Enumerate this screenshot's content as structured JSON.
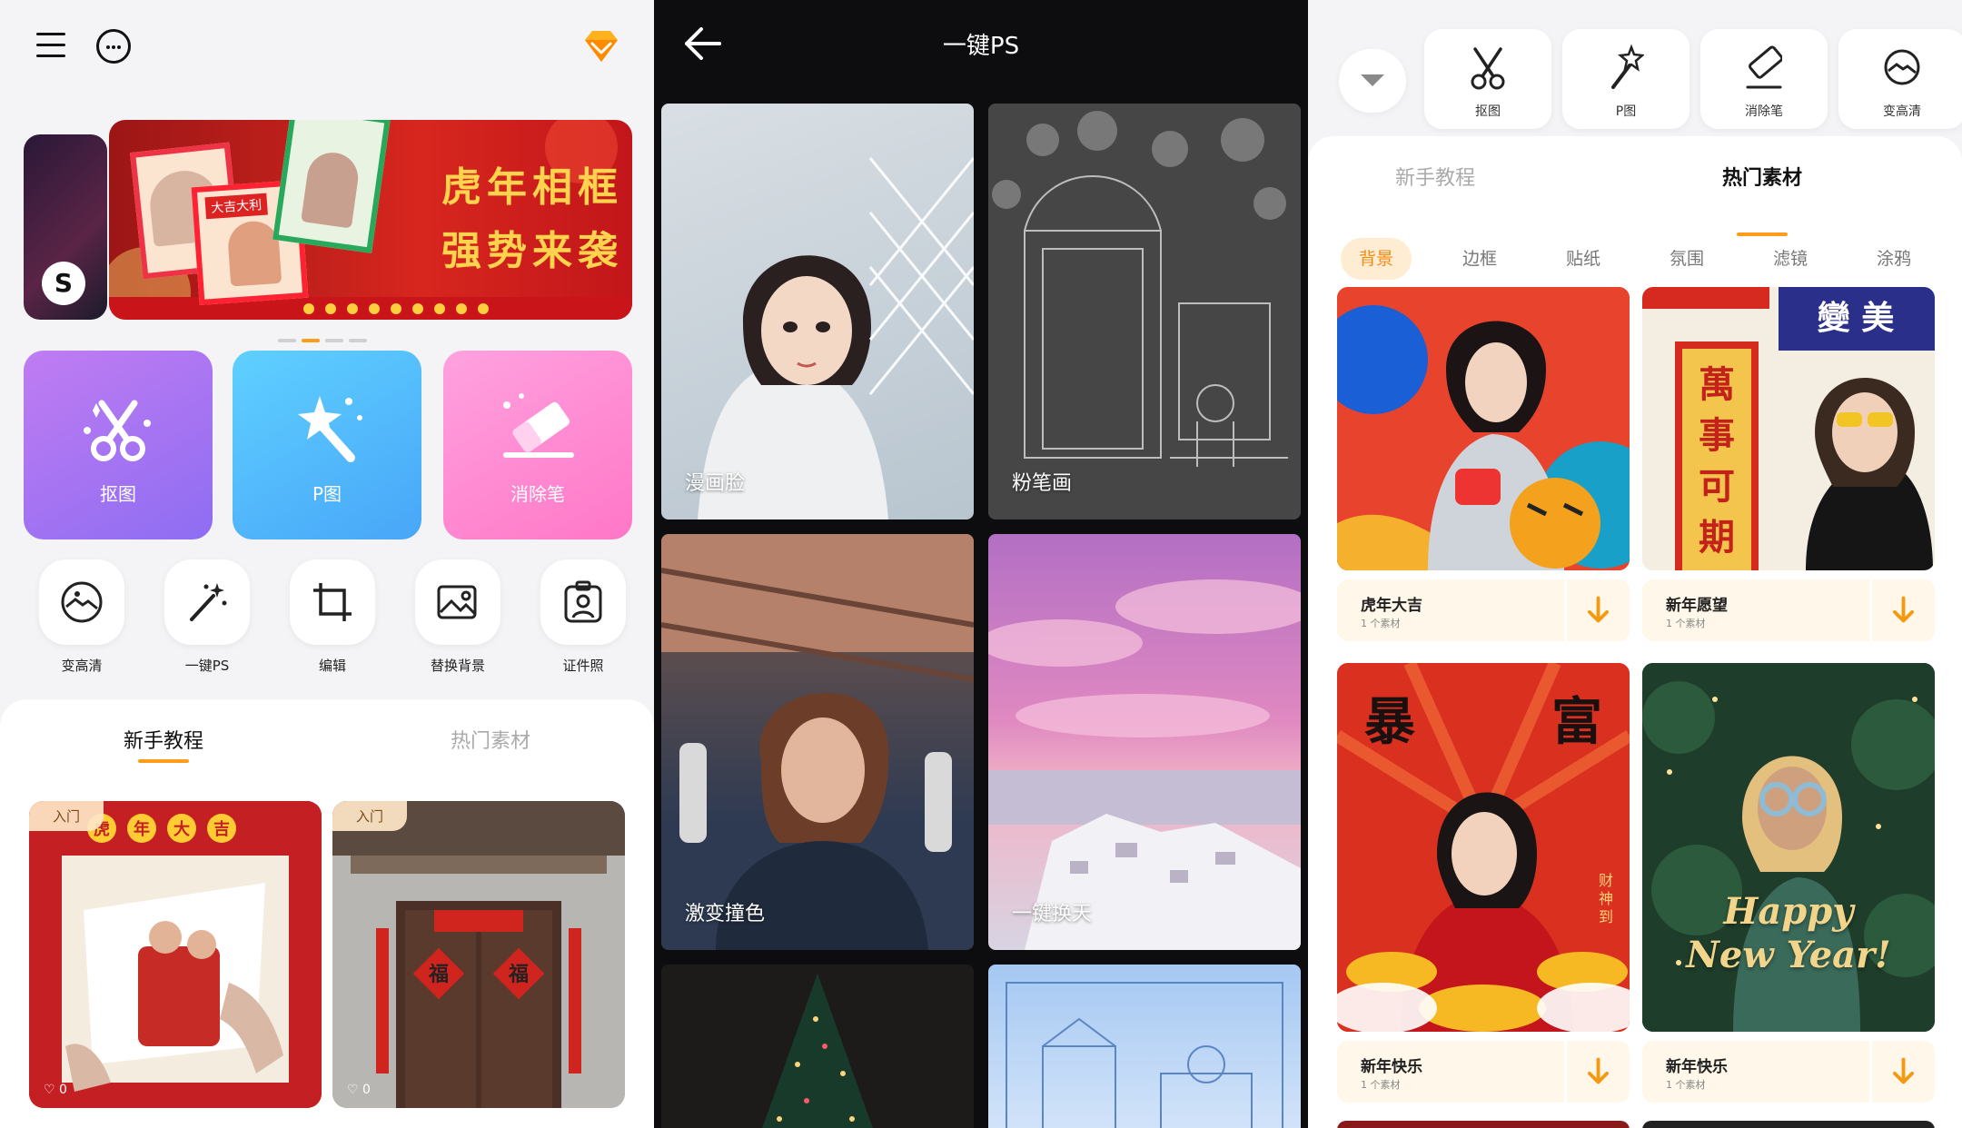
{
  "colors": {
    "accent": "#ff9d1a",
    "accent_bg": "#ffedd3",
    "dark_bg": "#0d0d0f"
  },
  "home": {
    "banner_text": [
      "虎年相框",
      "强势来袭"
    ],
    "banner_inner_tag": "大吉大利",
    "banner_s": "S",
    "big_tools": [
      {
        "label": "抠图",
        "icon": "scissors-icon"
      },
      {
        "label": "P图",
        "icon": "magic-wand-icon"
      },
      {
        "label": "消除笔",
        "icon": "eraser-icon"
      }
    ],
    "small_tools": [
      {
        "label": "变高清",
        "icon": "clarity-icon"
      },
      {
        "label": "一键PS",
        "icon": "magic-wand-icon"
      },
      {
        "label": "编辑",
        "icon": "crop-icon"
      },
      {
        "label": "替换背景",
        "icon": "image-replace-icon"
      },
      {
        "label": "证件照",
        "icon": "id-photo-icon"
      }
    ],
    "tabs": [
      "新手教程",
      "热门素材"
    ],
    "active_tab": "新手教程",
    "cards": [
      {
        "tag": "入门",
        "likes": "0",
        "title_art": "虎年大吉"
      },
      {
        "tag": "入门",
        "likes": "0",
        "title_art": "福"
      }
    ]
  },
  "oneps": {
    "title": "一键PS",
    "items": [
      {
        "caption": "漫画脸"
      },
      {
        "caption": "粉笔画"
      },
      {
        "caption": "激变撞色"
      },
      {
        "caption": "一键换天"
      },
      {
        "caption": ""
      },
      {
        "caption": ""
      }
    ]
  },
  "materials": {
    "tools": [
      {
        "label": "抠图",
        "icon": "scissors-icon"
      },
      {
        "label": "P图",
        "icon": "magic-wand-icon"
      },
      {
        "label": "消除笔",
        "icon": "eraser-icon"
      },
      {
        "label": "变高清",
        "icon": "clarity-icon"
      }
    ],
    "tabs": [
      "新手教程",
      "热门素材"
    ],
    "active_tab": "热门素材",
    "subtabs": [
      "背景",
      "边框",
      "贴纸",
      "氛围",
      "滤镜",
      "涂鸦"
    ],
    "active_subtab": "背景",
    "cards": [
      {
        "name": "虎年大吉",
        "count": "1 个素材"
      },
      {
        "name": "新年愿望",
        "count": "1 个素材",
        "art_text": [
          "萬",
          "事",
          "可",
          "期"
        ],
        "art_top": "變 美"
      },
      {
        "name": "新年快乐",
        "count": "1 个素材",
        "art_text": [
          "暴",
          "富"
        ],
        "art_side": "财神到"
      },
      {
        "name": "新年快乐",
        "count": "1 个素材",
        "art_text": [
          "Happy",
          "New Year!"
        ]
      }
    ]
  }
}
